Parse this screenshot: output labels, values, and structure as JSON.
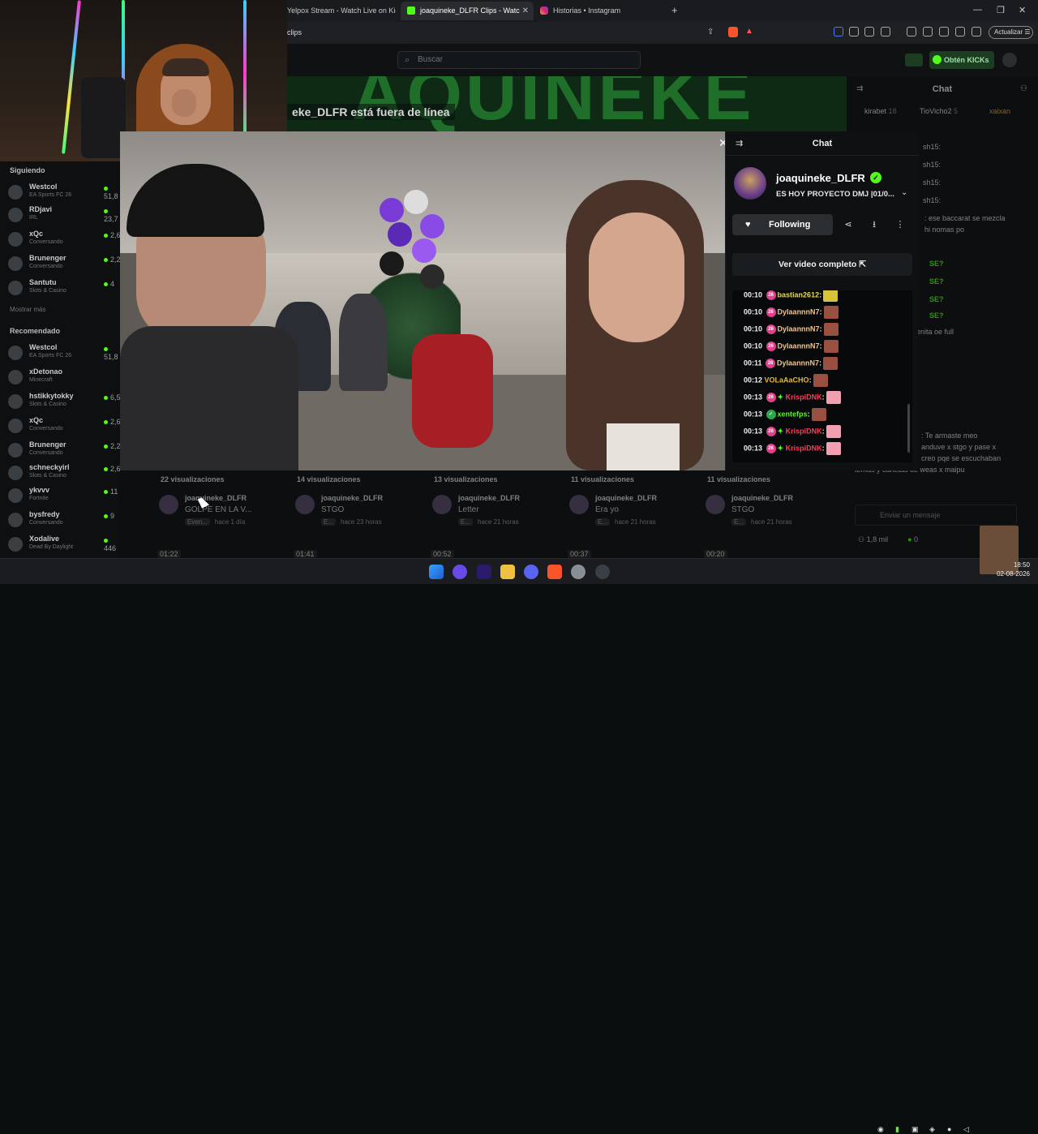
{
  "browser": {
    "tabs": [
      {
        "label": "Yelpox Stream - Watch Live on Kick"
      },
      {
        "label": "joaquineke_DLFR Clips - Watc"
      },
      {
        "label": "Historias • Instagram"
      }
    ],
    "new_tab": "+",
    "address": "clips",
    "update_label": "Actualizar"
  },
  "site": {
    "search_placeholder": "Buscar",
    "get_kicks": "Obtén KICKs",
    "offline_text": "eke_DLFR está fuera de línea",
    "banner_text": "AQUINEKE"
  },
  "sidebar": {
    "following_title": "Siguiendo",
    "following": [
      {
        "name": "Westcol",
        "game": "EA Sports FC 26",
        "viewers": "51,8"
      },
      {
        "name": "RDjavi",
        "game": "IRL",
        "viewers": "23,7"
      },
      {
        "name": "xQc",
        "game": "Conversando",
        "viewers": "2,6"
      },
      {
        "name": "Brunenger",
        "game": "Conversando",
        "viewers": "2,2"
      },
      {
        "name": "Santutu",
        "game": "Slots & Casino",
        "viewers": "4"
      }
    ],
    "show_more": "Mostrar más",
    "recommended_title": "Recomendado",
    "recommended": [
      {
        "name": "Westcol",
        "game": "EA Sports FC 26",
        "viewers": "51,8"
      },
      {
        "name": "xDetonao",
        "game": "Minecraft",
        "viewers": ""
      },
      {
        "name": "hstikkytokky",
        "game": "Slots & Casino",
        "viewers": "6,5"
      },
      {
        "name": "xQc",
        "game": "Conversando",
        "viewers": "2,6"
      },
      {
        "name": "Brunenger",
        "game": "Conversando",
        "viewers": "2,2"
      },
      {
        "name": "schneckyirl",
        "game": "Slots & Casino",
        "viewers": "2,6"
      },
      {
        "name": "ykvvv",
        "game": "Fortnite",
        "viewers": "11"
      },
      {
        "name": "bysfredy",
        "game": "Conversando",
        "viewers": "9"
      },
      {
        "name": "Xodalive",
        "game": "Dead By Daylight",
        "viewers": "446"
      }
    ]
  },
  "chat_panel": {
    "title": "Chat",
    "channel": "joaquineke_DLFR",
    "stream_title": "ES HOY PROYECTO DMJ |01/0...",
    "follow_label": "Following",
    "full_video": "Ver video completo",
    "messages": [
      {
        "time": "00:10",
        "user": "bastian2612",
        "color": "#e6d84a",
        "badge": "26"
      },
      {
        "time": "00:10",
        "user": "DylaannnN7",
        "color": "#f2c48e",
        "badge": "26"
      },
      {
        "time": "00:10",
        "user": "DylaannnN7",
        "color": "#f2c48e",
        "badge": "26"
      },
      {
        "time": "00:10",
        "user": "DylaannnN7",
        "color": "#f2c48e",
        "badge": "26"
      },
      {
        "time": "00:11",
        "user": "DylaannnN7",
        "color": "#f2c48e",
        "badge": "26"
      },
      {
        "time": "00:12",
        "user": "VOLaAaCHO",
        "color": "#e6b93a",
        "badge": ""
      },
      {
        "time": "00:13",
        "user": "KrispiDNK",
        "color": "#ff3b5c",
        "badge": "26"
      },
      {
        "time": "00:13",
        "user": "xentefps",
        "color": "#53fc18",
        "badge": ""
      },
      {
        "time": "00:13",
        "user": "KrispiDNK",
        "color": "#ff3b5c",
        "badge": "26"
      },
      {
        "time": "00:13",
        "user": "KrispiDNK",
        "color": "#ff3b5c",
        "badge": "26"
      }
    ]
  },
  "right_chat": {
    "title": "Chat",
    "top_users": [
      {
        "name": "kirabet",
        "count": "18"
      },
      {
        "name": "TioVicho2",
        "count": "5"
      },
      {
        "name": "xaixan",
        "count": ""
      }
    ],
    "lines": [
      "sh15:",
      "sh15:",
      "sh15:",
      "sh15:",
      ": ese baccarat se mezcla",
      "hi nomas po",
      "SE?",
      "SE?",
      "SE?",
      "SE?",
      "a cadenita oe full",
      ": Te armaste meo",
      "anduve x stgo y pase x",
      "creo pqe se escuchaban",
      "temas y cañetas de weas x maipu"
    ],
    "input_placeholder": "Enviar un mensaje",
    "viewers": "1,8 mil",
    "count": "0"
  },
  "clips": [
    {
      "views": "22 visualizaciones",
      "channel": "joaquineke_DLFR",
      "title": "GOLPE EN LA V...",
      "category": "Even...",
      "age": "hace 1 día",
      "duration": "01:22"
    },
    {
      "views": "14 visualizaciones",
      "channel": "joaquineke_DLFR",
      "title": "STGO",
      "category": "E...",
      "age": "hace 23 horas",
      "duration": "01:41"
    },
    {
      "views": "13 visualizaciones",
      "channel": "joaquineke_DLFR",
      "title": "Letter",
      "category": "E...",
      "age": "hace 21 horas",
      "duration": "00:52"
    },
    {
      "views": "11 visualizaciones",
      "channel": "joaquineke_DLFR",
      "title": "Era yo",
      "category": "E...",
      "age": "hace 21 horas",
      "duration": "00:37"
    },
    {
      "views": "11 visualizaciones",
      "channel": "joaquineke_DLFR",
      "title": "STGO",
      "category": "E...",
      "age": "hace 21 horas",
      "duration": "00:20"
    }
  ],
  "taskbar": {
    "time": "18:50",
    "date": "02-08-2026"
  },
  "colors": {
    "kick_green": "#53fc18",
    "background": "#0b0e0f"
  }
}
